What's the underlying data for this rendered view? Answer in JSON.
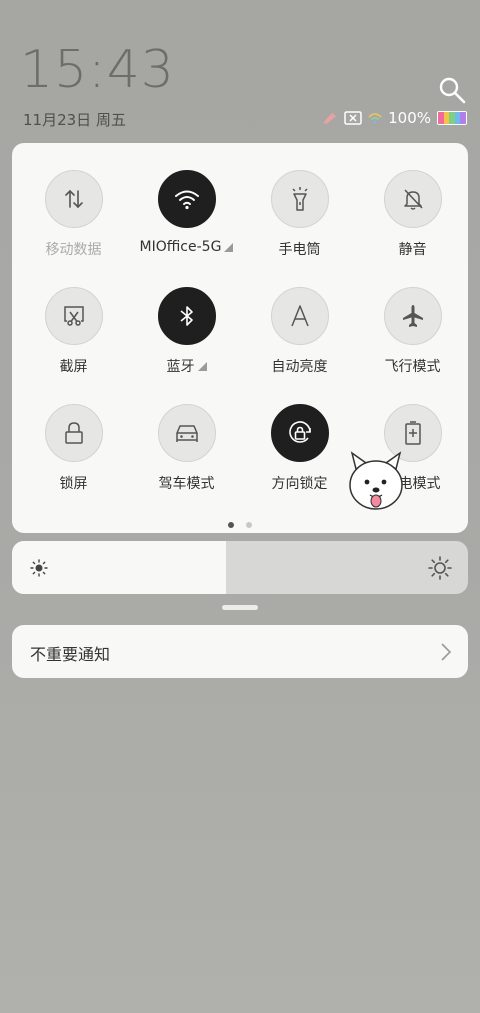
{
  "header": {
    "time": "15:43",
    "date": "11月23日 周五",
    "battery_pct": "100%",
    "search_icon": "search-icon"
  },
  "tiles": [
    {
      "label": "移动数据",
      "icon": "mobile-data-icon",
      "on": false,
      "dim": true,
      "signal": false
    },
    {
      "label": "MIOffice-5G",
      "icon": "wifi-icon",
      "on": true,
      "dim": false,
      "signal": true
    },
    {
      "label": "手电筒",
      "icon": "flashlight-icon",
      "on": false,
      "dim": false,
      "signal": false
    },
    {
      "label": "静音",
      "icon": "silent-bell-icon",
      "on": false,
      "dim": false,
      "signal": false
    },
    {
      "label": "截屏",
      "icon": "screenshot-icon",
      "on": false,
      "dim": false,
      "signal": false
    },
    {
      "label": "蓝牙",
      "icon": "bluetooth-icon",
      "on": true,
      "dim": false,
      "signal": true
    },
    {
      "label": "自动亮度",
      "icon": "auto-brightness-icon",
      "on": false,
      "dim": false,
      "signal": false
    },
    {
      "label": "飞行模式",
      "icon": "airplane-icon",
      "on": false,
      "dim": false,
      "signal": false
    },
    {
      "label": "锁屏",
      "icon": "lock-icon",
      "on": false,
      "dim": false,
      "signal": false
    },
    {
      "label": "驾车模式",
      "icon": "car-icon",
      "on": false,
      "dim": false,
      "signal": false
    },
    {
      "label": "方向锁定",
      "icon": "rotation-lock-icon",
      "on": true,
      "dim": false,
      "signal": false
    },
    {
      "label": "省电模式",
      "icon": "battery-saver-icon",
      "on": false,
      "dim": false,
      "signal": false
    }
  ],
  "pager": {
    "pages": 2,
    "active": 0
  },
  "brightness": {
    "level_pct": 47
  },
  "notification": {
    "label": "不重要通知"
  },
  "colors": {
    "tile_on": "#1f1f1f",
    "tile_off": "#e6e6e5",
    "panel": "#f8f8f7"
  }
}
